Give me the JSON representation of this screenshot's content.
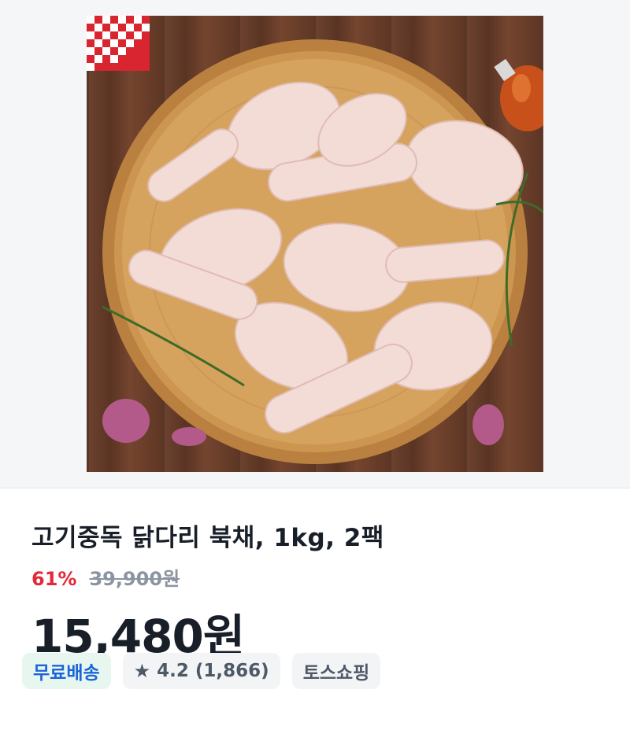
{
  "product": {
    "title": "고기중독 닭다리 북채, 1kg, 2팩",
    "discount_rate": "61%",
    "original_price": "39,900원",
    "price": "15,480원"
  },
  "badges": {
    "free_shipping": "무료배송",
    "rating_icon": "star-icon",
    "rating": "4.2",
    "review_count": "(1,866)",
    "store": "토스쇼핑"
  }
}
